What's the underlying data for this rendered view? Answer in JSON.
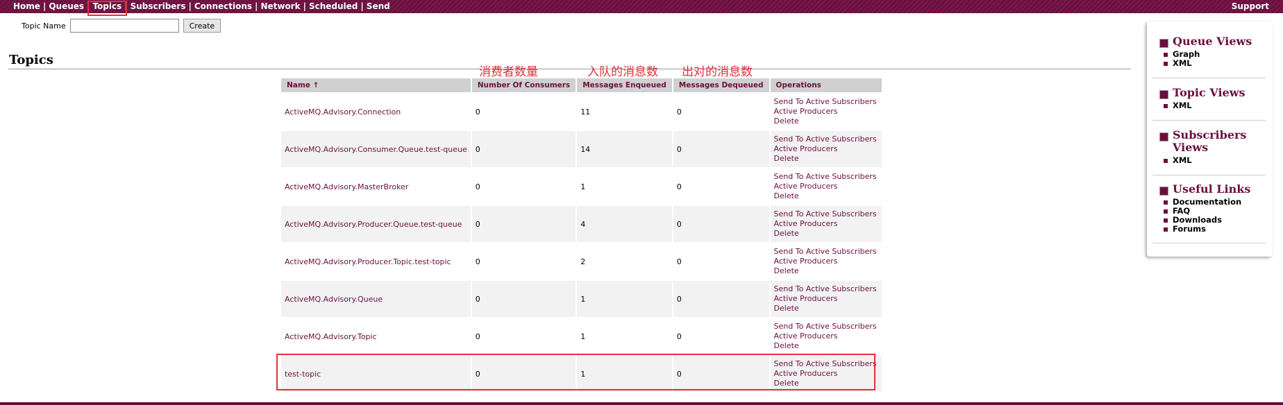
{
  "nav": {
    "items": [
      "Home",
      "Queues",
      "Topics",
      "Subscribers",
      "Connections",
      "Network",
      "Scheduled",
      "Send"
    ],
    "support": "Support"
  },
  "form": {
    "label": "Topic Name",
    "value": "",
    "create": "Create"
  },
  "page_title": "Topics",
  "annotations": {
    "consumers": "消费者数量",
    "enqueued": "入队的消息数",
    "dequeued": "出对的消息数"
  },
  "table": {
    "headers": {
      "name": "Name ↑",
      "consumers": "Number Of Consumers",
      "enqueued": "Messages Enqueued",
      "dequeued": "Messages Dequeued",
      "operations": "Operations"
    },
    "ops": {
      "send": "Send To Active Subscribers",
      "producers": "Active Producers",
      "delete": "Delete"
    },
    "rows": [
      {
        "name": "ActiveMQ.Advisory.Connection",
        "consumers": "0",
        "enqueued": "11",
        "dequeued": "0"
      },
      {
        "name": "ActiveMQ.Advisory.Consumer.Queue.test-queue",
        "consumers": "0",
        "enqueued": "14",
        "dequeued": "0"
      },
      {
        "name": "ActiveMQ.Advisory.MasterBroker",
        "consumers": "0",
        "enqueued": "1",
        "dequeued": "0"
      },
      {
        "name": "ActiveMQ.Advisory.Producer.Queue.test-queue",
        "consumers": "0",
        "enqueued": "4",
        "dequeued": "0"
      },
      {
        "name": "ActiveMQ.Advisory.Producer.Topic.test-topic",
        "consumers": "0",
        "enqueued": "2",
        "dequeued": "0"
      },
      {
        "name": "ActiveMQ.Advisory.Queue",
        "consumers": "0",
        "enqueued": "1",
        "dequeued": "0"
      },
      {
        "name": "ActiveMQ.Advisory.Topic",
        "consumers": "0",
        "enqueued": "1",
        "dequeued": "0"
      },
      {
        "name": "test-topic",
        "consumers": "0",
        "enqueued": "1",
        "dequeued": "0"
      }
    ]
  },
  "sidebar": {
    "queue_views": {
      "title": "Queue Views",
      "items": [
        "Graph",
        "XML"
      ]
    },
    "topic_views": {
      "title": "Topic Views",
      "items": [
        "XML"
      ]
    },
    "subscribers_views": {
      "title": "Subscribers Views",
      "items": [
        "XML"
      ]
    },
    "useful_links": {
      "title": "Useful Links",
      "items": [
        "Documentation",
        "FAQ",
        "Downloads",
        "Forums"
      ]
    }
  },
  "colors": {
    "brand": "#6c0f3f",
    "highlight": "#e0303a",
    "header_bg": "#d0d0d0",
    "row_alt": "#f2f2f2"
  }
}
